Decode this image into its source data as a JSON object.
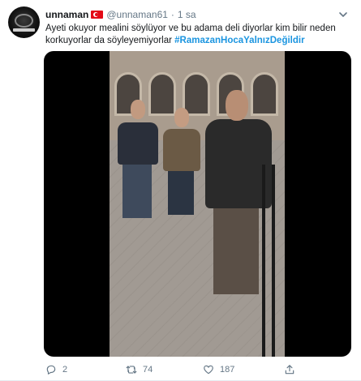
{
  "tweet": {
    "display_name": "unnaman",
    "flag_icon": "turkey-flag-icon",
    "handle": "@unnaman61",
    "separator": "·",
    "time": "1 sa",
    "text_plain": "Ayeti okuyor mealini söylüyor ve bu adama deli diyorlar kim bilir neden korkuyorlar da söyleyemiyorlar ",
    "hashtag": "#RamazanHocaYalnızDeğildir",
    "media": {
      "type": "video",
      "description_icon": "video-thumbnail"
    },
    "actions": {
      "reply_count": "2",
      "retweet_count": "74",
      "like_count": "187",
      "share_label": ""
    }
  },
  "colors": {
    "link": "#1b95e0",
    "secondary_text": "#657786",
    "primary_text": "#14171a"
  }
}
